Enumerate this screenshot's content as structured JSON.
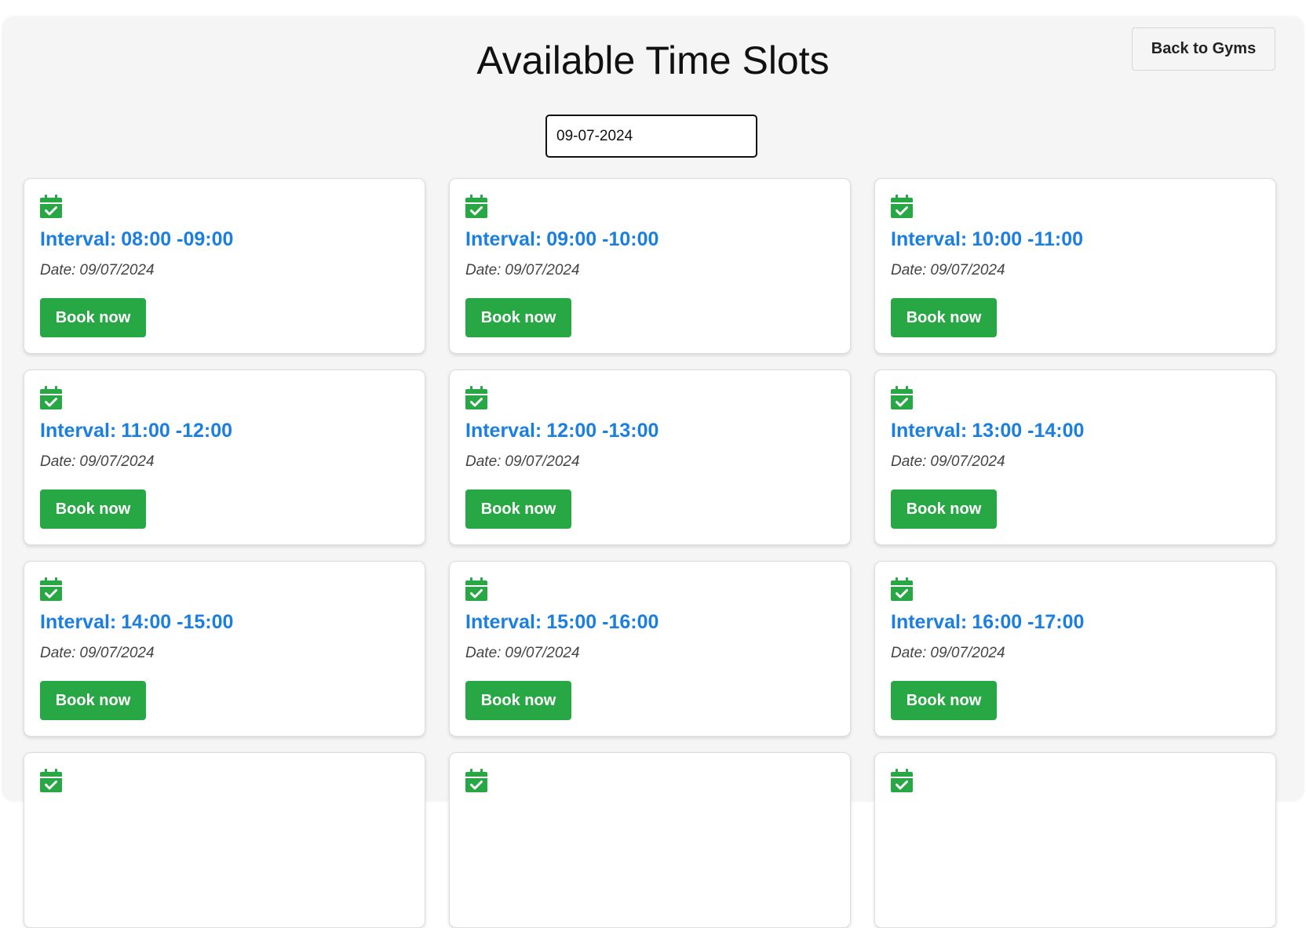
{
  "page": {
    "title": "Available Time Slots",
    "back_button_label": "Back to Gyms",
    "date_value": "09-07-2024"
  },
  "labels": {
    "interval_prefix": "Interval:",
    "date_prefix": "Date:",
    "book_button": "Book now"
  },
  "slots": [
    {
      "interval": "08:00 -09:00",
      "date": "09/07/2024"
    },
    {
      "interval": "09:00 -10:00",
      "date": "09/07/2024"
    },
    {
      "interval": "10:00 -11:00",
      "date": "09/07/2024"
    },
    {
      "interval": "11:00 -12:00",
      "date": "09/07/2024"
    },
    {
      "interval": "12:00 -13:00",
      "date": "09/07/2024"
    },
    {
      "interval": "13:00 -14:00",
      "date": "09/07/2024"
    },
    {
      "interval": "14:00 -15:00",
      "date": "09/07/2024"
    },
    {
      "interval": "15:00 -16:00",
      "date": "09/07/2024"
    },
    {
      "interval": "16:00 -17:00",
      "date": "09/07/2024"
    }
  ],
  "partial_slots_visible": 3,
  "icons": {
    "slot_icon": "calendar-check-icon"
  },
  "colors": {
    "accent_blue": "#1a7fe0",
    "book_green": "#28a745",
    "panel_bg": "#f5f5f5",
    "card_bg": "#ffffff",
    "text_dark": "#111111"
  }
}
